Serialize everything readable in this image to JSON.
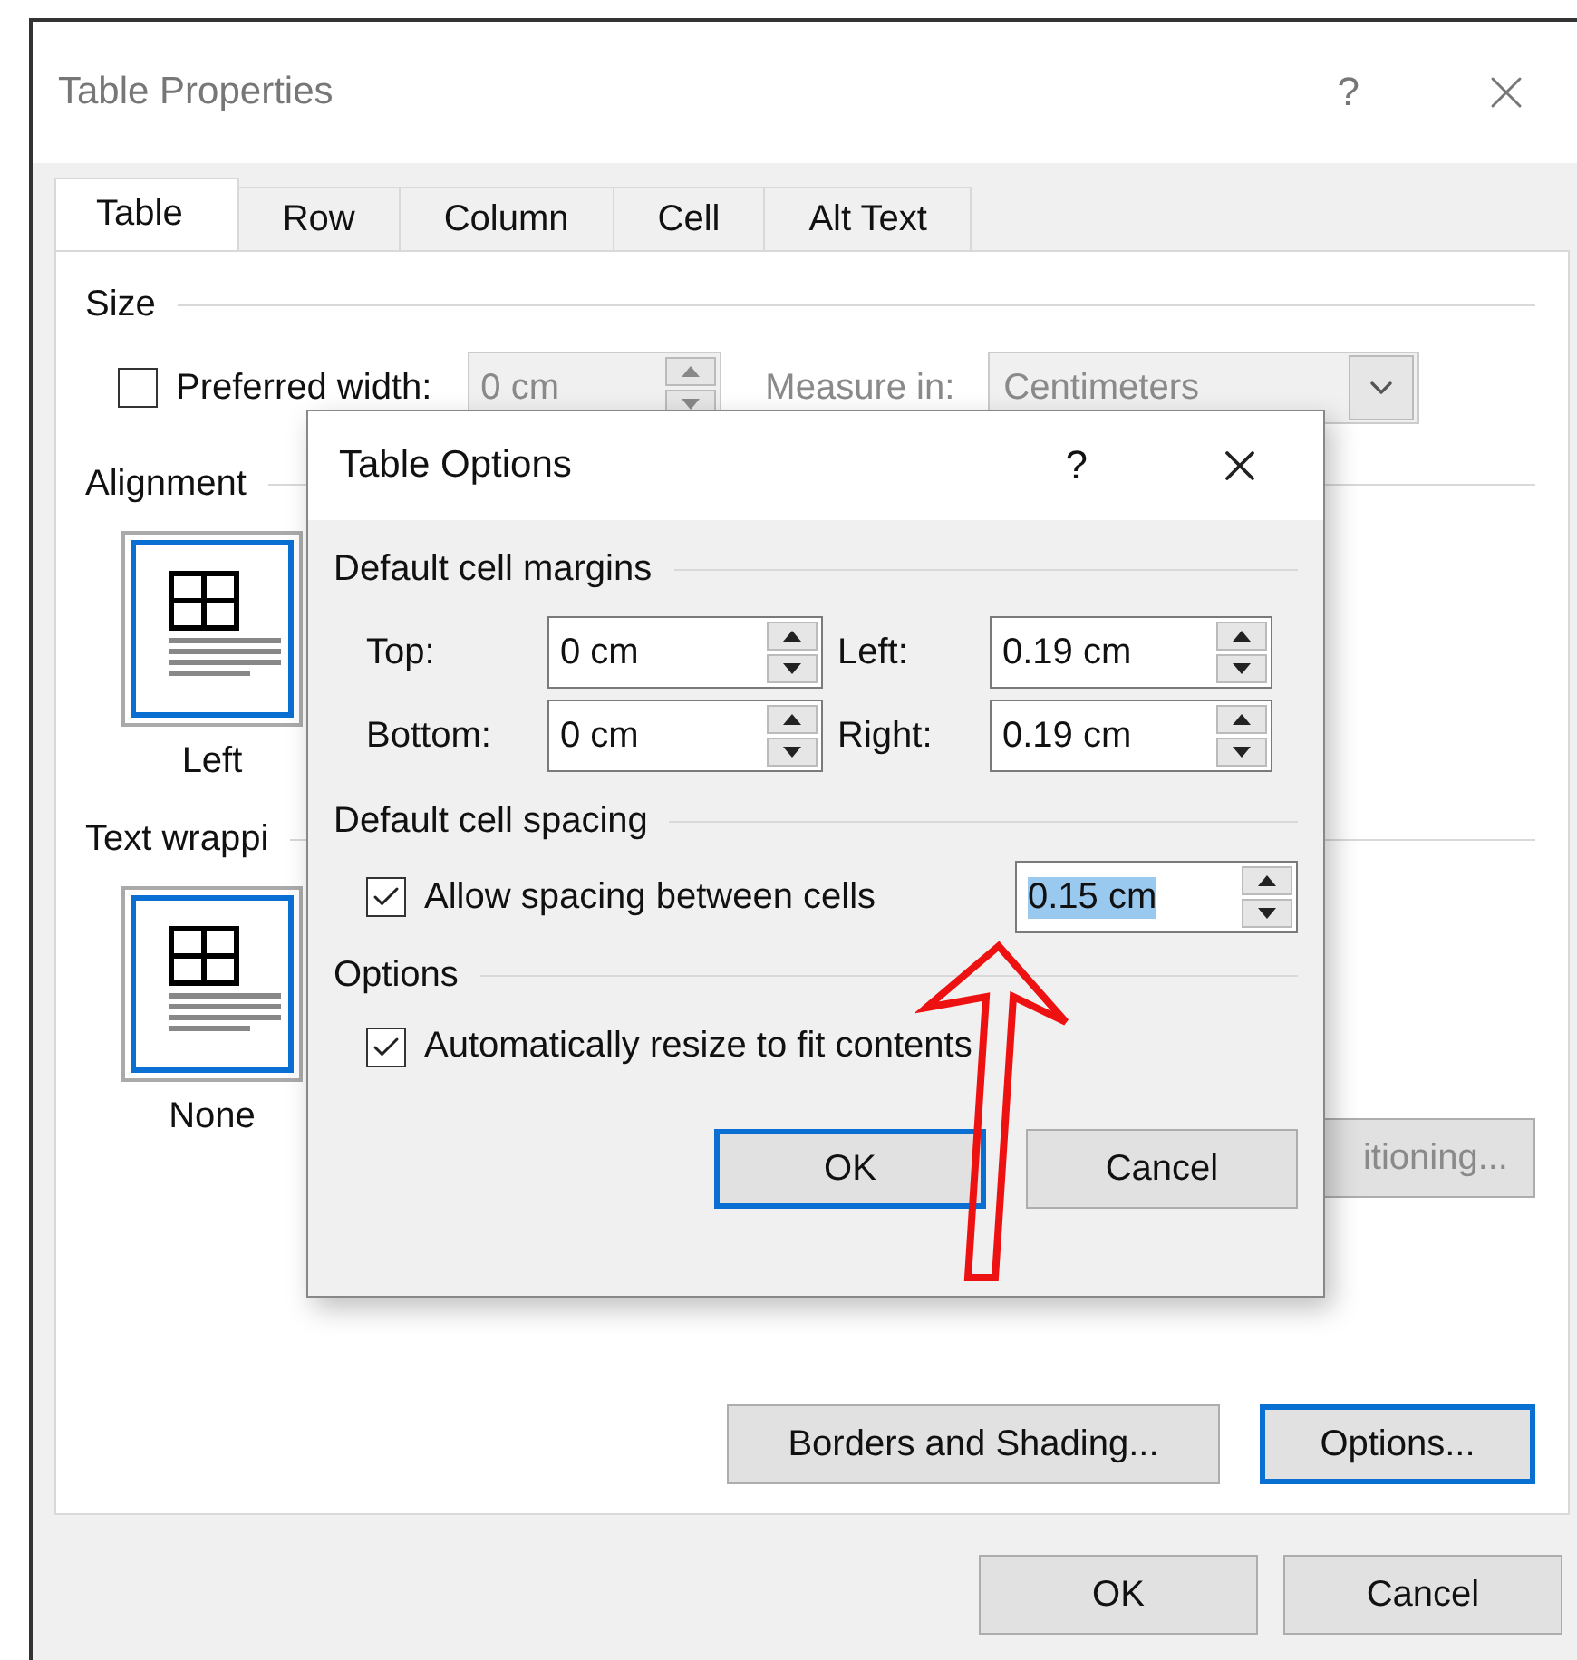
{
  "window": {
    "title": "Table Properties",
    "help": "?"
  },
  "tabs": [
    {
      "label": "Table",
      "selected": true
    },
    {
      "label": "Row",
      "selected": false
    },
    {
      "label": "Column",
      "selected": false
    },
    {
      "label": "Cell",
      "selected": false
    },
    {
      "label": "Alt Text",
      "selected": false
    }
  ],
  "size": {
    "heading": "Size",
    "preferred_width": {
      "label": "Preferred width:",
      "checked": false,
      "value": "0 cm",
      "disabled": true
    },
    "measure_in": {
      "label": "Measure in:",
      "value": "Centimeters",
      "disabled": true
    }
  },
  "alignment": {
    "heading": "Alignment",
    "options": [
      {
        "label": "Left",
        "selected": true
      }
    ]
  },
  "text_wrapping": {
    "heading": "Text wrappi",
    "options": [
      {
        "label": "None",
        "selected": true
      }
    ]
  },
  "positioning_button": {
    "label": "itioning...",
    "disabled": true
  },
  "panel_buttons": [
    {
      "label": "Borders and Shading...",
      "focused": false
    },
    {
      "label": "Options...",
      "focused": true
    }
  ],
  "footer_buttons": [
    "OK",
    "Cancel"
  ],
  "table_options": {
    "title": "Table Options",
    "help": "?",
    "margins": {
      "heading": "Default cell margins",
      "fields": [
        {
          "label": "Top:",
          "value": "0 cm"
        },
        {
          "label": "Left:",
          "value": "0.19 cm"
        },
        {
          "label": "Bottom:",
          "value": "0 cm"
        },
        {
          "label": "Right:",
          "value": "0.19 cm"
        }
      ]
    },
    "spacing": {
      "heading": "Default cell spacing",
      "checkbox": {
        "label": "Allow spacing between cells",
        "checked": true
      },
      "value": "0.15 cm",
      "value_selected": true
    },
    "options": {
      "heading": "Options",
      "checkbox": {
        "label": "Automatically resize to fit contents",
        "checked": true
      }
    },
    "buttons": [
      {
        "label": "OK",
        "focused": true
      },
      {
        "label": "Cancel",
        "focused": false
      }
    ]
  }
}
